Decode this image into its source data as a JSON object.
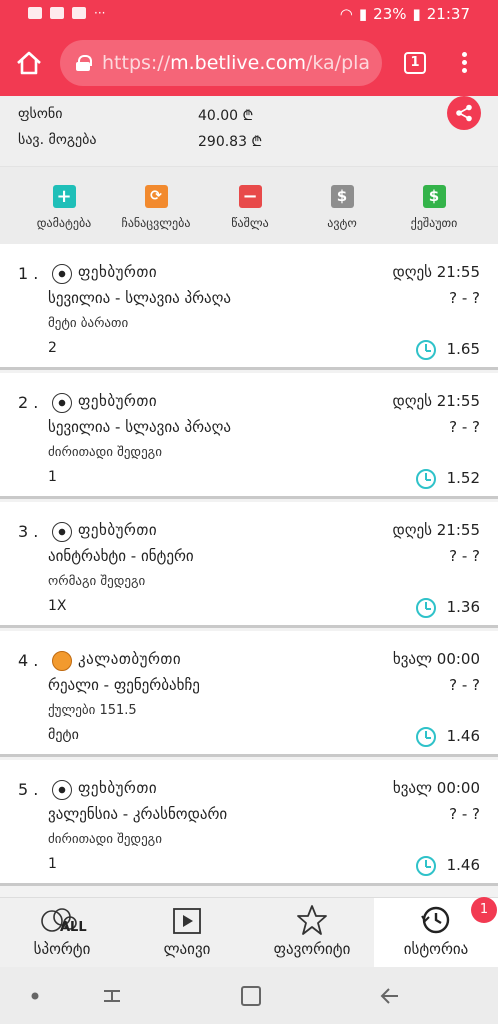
{
  "status_bar": {
    "battery": "23%",
    "time": "21:37"
  },
  "browser": {
    "url_prefix": "https://",
    "url_host": "m.betlive.com",
    "url_path": "/ka/pla",
    "tab_count": "1"
  },
  "summary": {
    "stake_label": "ფსონი",
    "stake_value": "40.00 ₾",
    "win_label": "სავ. მოგება",
    "win_value": "290.83 ₾"
  },
  "toolbar": {
    "add": "დამატება",
    "replace": "ჩანაცვლება",
    "delete": "წაშლა",
    "auto": "ავტო",
    "cashout": "ქეშაუთი"
  },
  "bets": [
    {
      "num": "1 .",
      "sport": "ფეხბურთი",
      "sport_icon": "soccer-ball-icon",
      "time": "დღეს 21:55",
      "match": "სევილია - სლავია პრაღა",
      "score": "? - ?",
      "market": "მეტი ბარათი",
      "pick": "2",
      "odds": "1.65"
    },
    {
      "num": "2 .",
      "sport": "ფეხბურთი",
      "sport_icon": "soccer-ball-icon",
      "time": "დღეს 21:55",
      "match": "სევილია - სლავია პრაღა",
      "score": "? - ?",
      "market": "ძირითადი შედეგი",
      "pick": "1",
      "odds": "1.52"
    },
    {
      "num": "3 .",
      "sport": "ფეხბურთი",
      "sport_icon": "soccer-ball-icon",
      "time": "დღეს 21:55",
      "match": "აინტრახტი - ინტერი",
      "score": "? - ?",
      "market": "ორმაგი შედეგი",
      "pick": "1X",
      "odds": "1.36"
    },
    {
      "num": "4 .",
      "sport": "კალათბურთი",
      "sport_icon": "basketball-icon",
      "time": "ხვალ 00:00",
      "match": "რეალი - ფენერბახჩე",
      "score": "? - ?",
      "market": "ქულები 151.5",
      "pick": "მეტი",
      "odds": "1.46"
    },
    {
      "num": "5 .",
      "sport": "ფეხბურთი",
      "sport_icon": "soccer-ball-icon",
      "time": "ხვალ 00:00",
      "match": "ვალენსია - კრასნოდარი",
      "score": "? - ?",
      "market": "ძირითადი შედეგი",
      "pick": "1",
      "odds": "1.46"
    }
  ],
  "bottom_nav": {
    "sports": "სპორტი",
    "sports_icon_text": "ALL",
    "live": "ლაივი",
    "favorites": "ფავორიტი",
    "history": "ისტორია",
    "history_badge": "1"
  },
  "colors": {
    "brand_red": "#f23a52",
    "add_green": "#1fbfb8",
    "replace_orange": "#f28a2e",
    "delete_red": "#e84a4a",
    "auto_gray": "#8e8e8e",
    "cashout_green": "#34b34a",
    "clock_teal": "#2fc2c9"
  }
}
